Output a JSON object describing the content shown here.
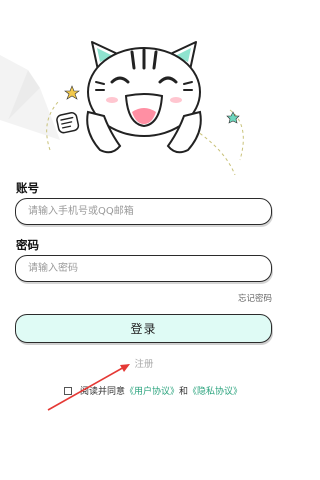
{
  "form": {
    "account_label": "账号",
    "account_placeholder": "请输入手机号或QQ邮箱",
    "password_label": "密码",
    "password_placeholder": "请输入密码",
    "forgot_password": "忘记密码",
    "login_button": "登录",
    "register_link": "注册"
  },
  "agreement": {
    "prefix": "阅读并同意",
    "user_agreement": "《用户协议》",
    "and": "和",
    "privacy_policy": "《隐私协议》"
  },
  "colors": {
    "accent": "#2aa37d",
    "button_bg": "#dffbf5",
    "arrow": "#e53935"
  }
}
